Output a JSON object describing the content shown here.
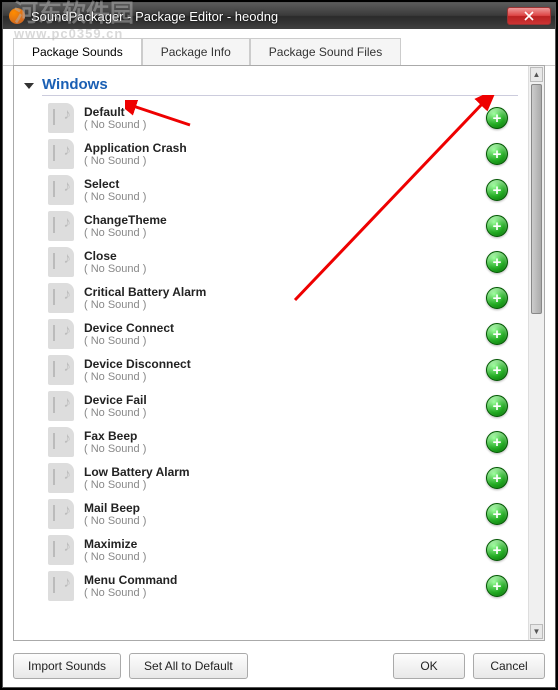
{
  "window": {
    "title": "SoundPackager - Package Editor - heodng"
  },
  "tabs": [
    {
      "label": "Package Sounds",
      "active": true
    },
    {
      "label": "Package Info",
      "active": false
    },
    {
      "label": "Package Sound Files",
      "active": false
    }
  ],
  "group": {
    "title": "Windows"
  },
  "no_sound_label": "( No Sound )",
  "sounds": [
    {
      "name": "Default"
    },
    {
      "name": "Application Crash"
    },
    {
      "name": "Select"
    },
    {
      "name": "ChangeTheme"
    },
    {
      "name": "Close"
    },
    {
      "name": "Critical Battery Alarm"
    },
    {
      "name": "Device Connect"
    },
    {
      "name": "Device Disconnect"
    },
    {
      "name": "Device Fail"
    },
    {
      "name": "Fax Beep"
    },
    {
      "name": "Low Battery Alarm"
    },
    {
      "name": "Mail Beep"
    },
    {
      "name": "Maximize"
    },
    {
      "name": "Menu Command"
    }
  ],
  "buttons": {
    "import": "Import Sounds",
    "reset": "Set All to Default",
    "ok": "OK",
    "cancel": "Cancel"
  },
  "watermark": {
    "line1": "河东软件园",
    "line2": "www.pc0359.cn"
  }
}
